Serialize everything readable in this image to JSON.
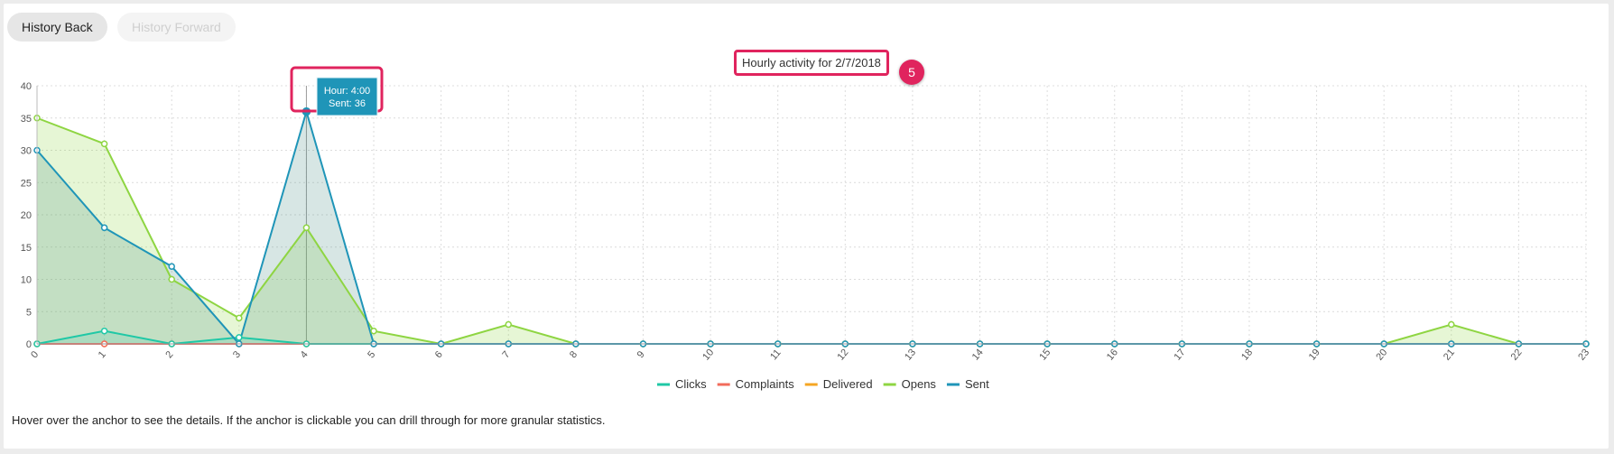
{
  "nav": {
    "back_label": "History Back",
    "forward_label": "History Forward"
  },
  "chart_title": "Hourly activity for 2/7/2018",
  "badge": "5",
  "tooltip": {
    "line1": "Hour: 4:00",
    "line2": "Sent: 36"
  },
  "footnote": "Hover over the anchor to see the details. If the anchor is clickable you can drill through for more granular statistics.",
  "colors": {
    "clicks": "#1fc8a6",
    "complaints": "#f26b5b",
    "delivered": "#f5a623",
    "opens": "#8ed542",
    "sent": "#1f95b8",
    "highlight": "#e0245e"
  },
  "chart_data": {
    "type": "area",
    "title": "Hourly activity for 2/7/2018",
    "x": [
      0,
      1,
      2,
      3,
      4,
      5,
      6,
      7,
      8,
      9,
      10,
      11,
      12,
      13,
      14,
      15,
      16,
      17,
      18,
      19,
      20,
      21,
      22,
      23
    ],
    "xlim": [
      0,
      23
    ],
    "ylim": [
      0,
      40
    ],
    "yticks": [
      0,
      5,
      10,
      15,
      20,
      25,
      30,
      35,
      40
    ],
    "grid": true,
    "legend": "bottom",
    "series": [
      {
        "name": "Clicks",
        "key": "clicks",
        "values": [
          0,
          2,
          0,
          1,
          0,
          0,
          0,
          0,
          0,
          0,
          0,
          0,
          0,
          0,
          0,
          0,
          0,
          0,
          0,
          0,
          0,
          0,
          0,
          0
        ]
      },
      {
        "name": "Complaints",
        "key": "complaints",
        "values": [
          0,
          0,
          0,
          0,
          0,
          0,
          0,
          0,
          0,
          0,
          0,
          0,
          0,
          0,
          0,
          0,
          0,
          0,
          0,
          0,
          0,
          0,
          0,
          0
        ]
      },
      {
        "name": "Delivered",
        "key": "delivered",
        "values": [
          0,
          0,
          0,
          0,
          0,
          0,
          0,
          0,
          0,
          0,
          0,
          0,
          0,
          0,
          0,
          0,
          0,
          0,
          0,
          0,
          0,
          0,
          0,
          0
        ]
      },
      {
        "name": "Opens",
        "key": "opens",
        "values": [
          35,
          31,
          10,
          4,
          18,
          2,
          0,
          3,
          0,
          0,
          0,
          0,
          0,
          0,
          0,
          0,
          0,
          0,
          0,
          0,
          0,
          3,
          0,
          0
        ]
      },
      {
        "name": "Sent",
        "key": "sent",
        "values": [
          30,
          18,
          12,
          0,
          36,
          0,
          0,
          0,
          0,
          0,
          0,
          0,
          0,
          0,
          0,
          0,
          0,
          0,
          0,
          0,
          0,
          0,
          0,
          0
        ]
      }
    ],
    "tooltip_at": {
      "x": 4,
      "series": "sent"
    }
  }
}
